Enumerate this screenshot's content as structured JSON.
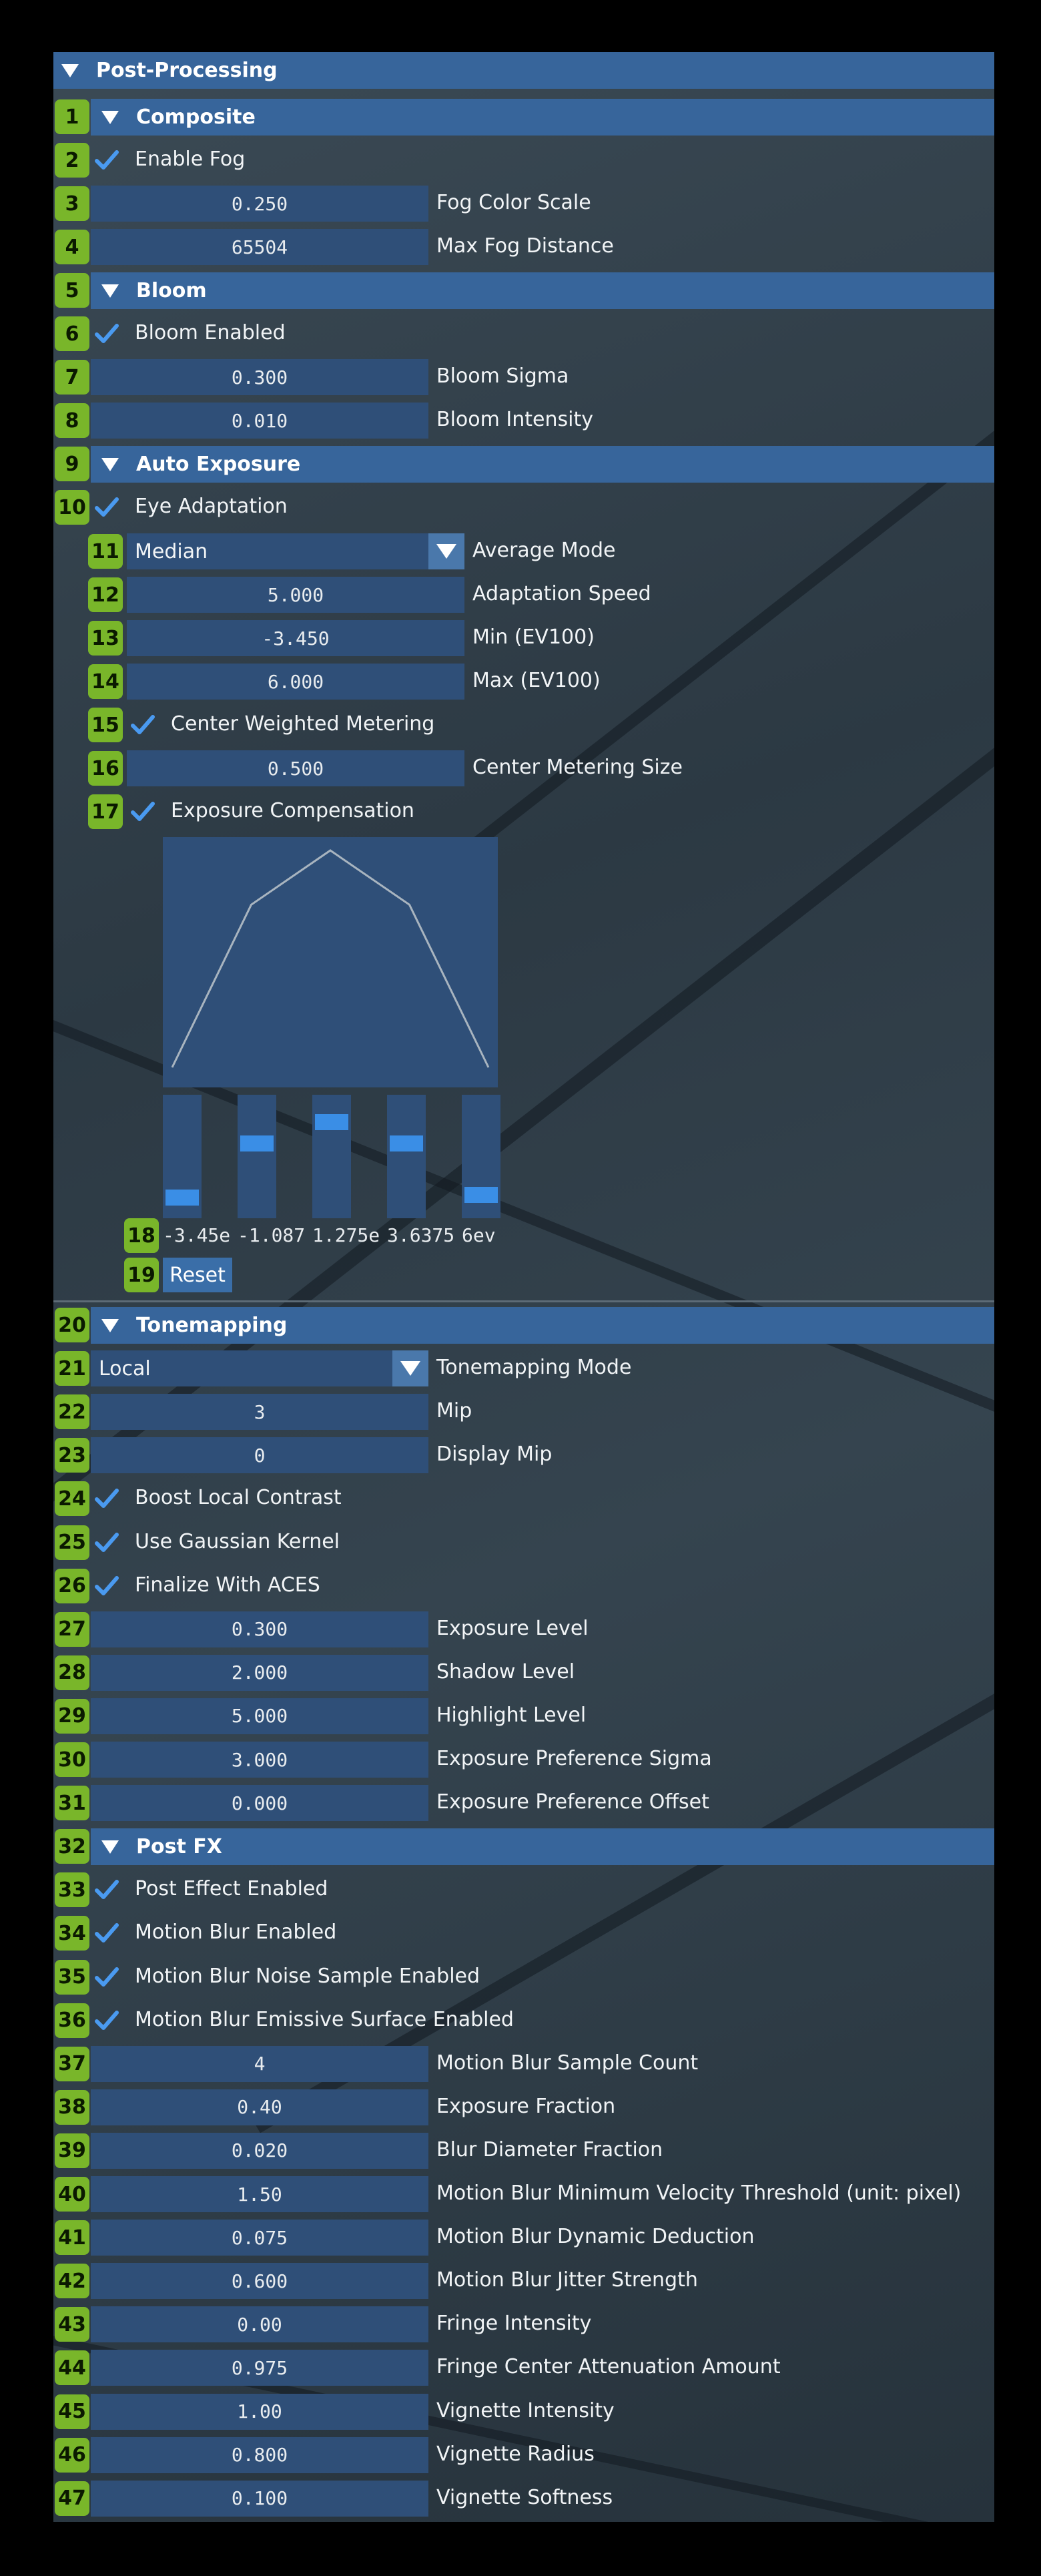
{
  "title": "Post-Processing",
  "rows": [
    {
      "type": "header",
      "num": "1",
      "label": "Composite"
    },
    {
      "type": "check",
      "num": "2",
      "label": "Enable Fog"
    },
    {
      "type": "field",
      "num": "3",
      "value": "0.250",
      "label": "Fog Color Scale"
    },
    {
      "type": "field",
      "num": "4",
      "value": "65504",
      "label": "Max Fog Distance"
    },
    {
      "type": "header",
      "num": "5",
      "label": "Bloom"
    },
    {
      "type": "check",
      "num": "6",
      "label": "Bloom Enabled"
    },
    {
      "type": "field",
      "num": "7",
      "value": "0.300",
      "label": "Bloom Sigma"
    },
    {
      "type": "field",
      "num": "8",
      "value": "0.010",
      "label": "Bloom Intensity"
    },
    {
      "type": "header",
      "num": "9",
      "label": "Auto Exposure"
    },
    {
      "type": "check",
      "num": "10",
      "label": "Eye Adaptation"
    }
  ],
  "auto": [
    {
      "type": "combo",
      "num": "11",
      "value": "Median",
      "label": "Average Mode"
    },
    {
      "type": "field",
      "num": "12",
      "value": "5.000",
      "label": "Adaptation Speed"
    },
    {
      "type": "field",
      "num": "13",
      "value": "-3.450",
      "label": "Min (EV100)"
    },
    {
      "type": "field",
      "num": "14",
      "value": "6.000",
      "label": "Max (EV100)"
    },
    {
      "type": "check",
      "num": "15",
      "label": "Center Weighted Metering"
    },
    {
      "type": "field",
      "num": "16",
      "value": "0.500",
      "label": "Center Metering Size"
    },
    {
      "type": "check",
      "num": "17",
      "label": "Exposure Compensation"
    }
  ],
  "curve_points": [
    0.0,
    0.75,
    1.0,
    0.75,
    0.0
  ],
  "sliders": [
    {
      "label": "-3.45e",
      "level": 0.12
    },
    {
      "label": "-1.087",
      "level": 0.62
    },
    {
      "label": "1.275e",
      "level": 0.82
    },
    {
      "label": "3.6375",
      "level": 0.62
    },
    {
      "label": "6ev",
      "level": 0.14
    }
  ],
  "slider_num": "18",
  "reset": {
    "num": "19",
    "label": "Reset"
  },
  "rows2": [
    {
      "type": "header",
      "num": "20",
      "label": "Tonemapping"
    },
    {
      "type": "combo",
      "num": "21",
      "value": "Local",
      "label": "Tonemapping Mode"
    },
    {
      "type": "field",
      "num": "22",
      "value": "3",
      "label": "Mip"
    },
    {
      "type": "field",
      "num": "23",
      "value": "0",
      "label": "Display Mip"
    },
    {
      "type": "check",
      "num": "24",
      "label": "Boost Local Contrast"
    },
    {
      "type": "check",
      "num": "25",
      "label": "Use Gaussian Kernel"
    },
    {
      "type": "check",
      "num": "26",
      "label": "Finalize With ACES"
    },
    {
      "type": "field",
      "num": "27",
      "value": "0.300",
      "label": "Exposure Level"
    },
    {
      "type": "field",
      "num": "28",
      "value": "2.000",
      "label": "Shadow Level"
    },
    {
      "type": "field",
      "num": "29",
      "value": "5.000",
      "label": "Highlight Level"
    },
    {
      "type": "field",
      "num": "30",
      "value": "3.000",
      "label": "Exposure Preference Sigma"
    },
    {
      "type": "field",
      "num": "31",
      "value": "0.000",
      "label": "Exposure Preference Offset"
    },
    {
      "type": "header",
      "num": "32",
      "label": "Post FX"
    },
    {
      "type": "check",
      "num": "33",
      "label": "Post Effect Enabled"
    },
    {
      "type": "check",
      "num": "34",
      "label": "Motion Blur Enabled"
    },
    {
      "type": "check",
      "num": "35",
      "label": "Motion Blur Noise Sample Enabled"
    },
    {
      "type": "check",
      "num": "36",
      "label": "Motion Blur Emissive Surface Enabled"
    },
    {
      "type": "field",
      "num": "37",
      "value": "4",
      "label": "Motion Blur Sample Count"
    },
    {
      "type": "field",
      "num": "38",
      "value": "0.40",
      "label": "Exposure Fraction"
    },
    {
      "type": "field",
      "num": "39",
      "value": "0.020",
      "label": "Blur Diameter Fraction"
    },
    {
      "type": "field",
      "num": "40",
      "value": "1.50",
      "label": "Motion Blur Minimum Velocity Threshold (unit: pixel)"
    },
    {
      "type": "field",
      "num": "41",
      "value": "0.075",
      "label": "Motion Blur Dynamic Deduction"
    },
    {
      "type": "field",
      "num": "42",
      "value": "0.600",
      "label": "Motion Blur Jitter Strength"
    },
    {
      "type": "field",
      "num": "43",
      "value": "0.00",
      "label": "Fringe Intensity"
    },
    {
      "type": "field",
      "num": "44",
      "value": "0.975",
      "label": "Fringe Center Attenuation Amount"
    },
    {
      "type": "field",
      "num": "45",
      "value": "1.00",
      "label": "Vignette Intensity"
    },
    {
      "type": "field",
      "num": "46",
      "value": "0.800",
      "label": "Vignette Radius"
    },
    {
      "type": "field",
      "num": "47",
      "value": "0.100",
      "label": "Vignette Softness"
    }
  ],
  "colors": {
    "header": "#37659b",
    "field": "#2f4f78",
    "badge": "#79b62a",
    "check": "#4a9af0"
  }
}
